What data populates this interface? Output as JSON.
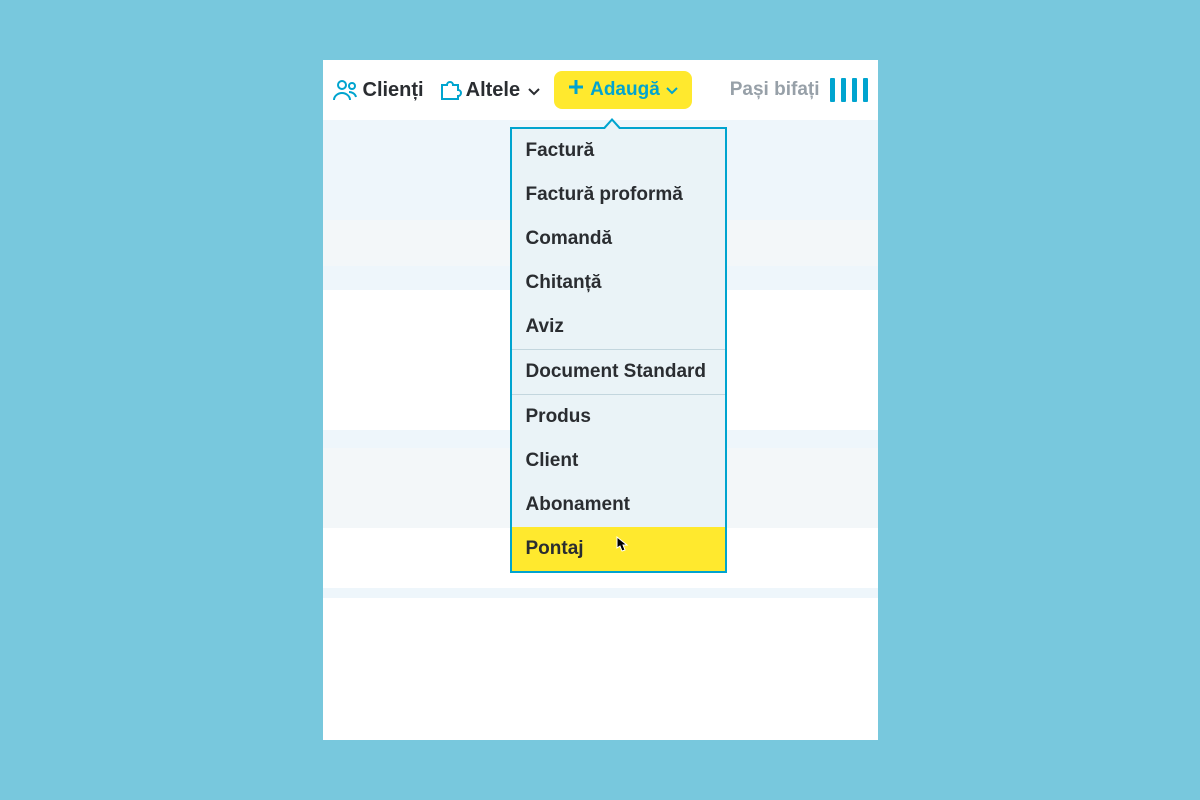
{
  "topbar": {
    "clienti_label": "Clienți",
    "altele_label": "Altele",
    "adauga_label": "Adaugă",
    "steps_label": "Pași bifați"
  },
  "dropdown": {
    "items": [
      {
        "label": "Factură"
      },
      {
        "label": "Factură proformă"
      },
      {
        "label": "Comandă"
      },
      {
        "label": "Chitanță"
      },
      {
        "label": "Aviz"
      },
      {
        "label": "Document Standard"
      },
      {
        "label": "Produs"
      },
      {
        "label": "Client"
      },
      {
        "label": "Abonament"
      },
      {
        "label": "Pontaj"
      }
    ]
  }
}
